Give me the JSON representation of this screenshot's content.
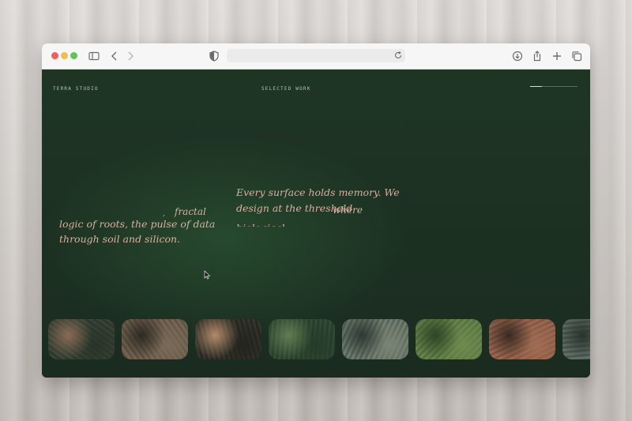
{
  "site": {
    "brand": "TERRA STUDIO",
    "section": "SELECTED WORK",
    "progress": 0.25
  },
  "poem_left": {
    "lines": [
      "logic of roots, the pulse of data",
      "through soil and silicon."
    ],
    "fragment_word": "fractal",
    "fragment_tick": ","
  },
  "poem_right": {
    "lines": [
      "Every surface holds memory. We",
      "design at the threshold"
    ],
    "fragment_word": "where",
    "fragment_partial": "biological"
  },
  "browser": {
    "icons": [
      "sidebar-icon",
      "back-arrow-icon",
      "forward-arrow-icon",
      "privacy-shield-icon",
      "reload-icon",
      "download-icon",
      "share-icon",
      "new-tab-plus-icon",
      "tabs-overview-icon"
    ],
    "traffic_lights": [
      "#ee5f57",
      "#f5bd4f",
      "#5fc553"
    ]
  },
  "thumbnails": [
    {
      "name": "river-roots",
      "colors": [
        "#3c4a3d",
        "#8a6a55",
        "#2a3429"
      ]
    },
    {
      "name": "root-network",
      "colors": [
        "#5a4c3f",
        "#2e2a22",
        "#7a6b58"
      ]
    },
    {
      "name": "bark-knot",
      "colors": [
        "#3a3a30",
        "#b38a6a",
        "#23241e"
      ]
    },
    {
      "name": "forest-canopy",
      "colors": [
        "#36523a",
        "#5f7d52",
        "#263a29"
      ]
    },
    {
      "name": "tree-aerial",
      "colors": [
        "#4b5a52",
        "#2d3a33",
        "#7a8474"
      ]
    },
    {
      "name": "moss-texture",
      "colors": [
        "#4e6a3c",
        "#2f4426",
        "#6f8a4e"
      ]
    },
    {
      "name": "leaf-veins",
      "colors": [
        "#7a5040",
        "#3a2a22",
        "#a06c52"
      ]
    },
    {
      "name": "water-ripple",
      "colors": [
        "#445048",
        "#2a332e",
        "#6a766e"
      ]
    }
  ]
}
